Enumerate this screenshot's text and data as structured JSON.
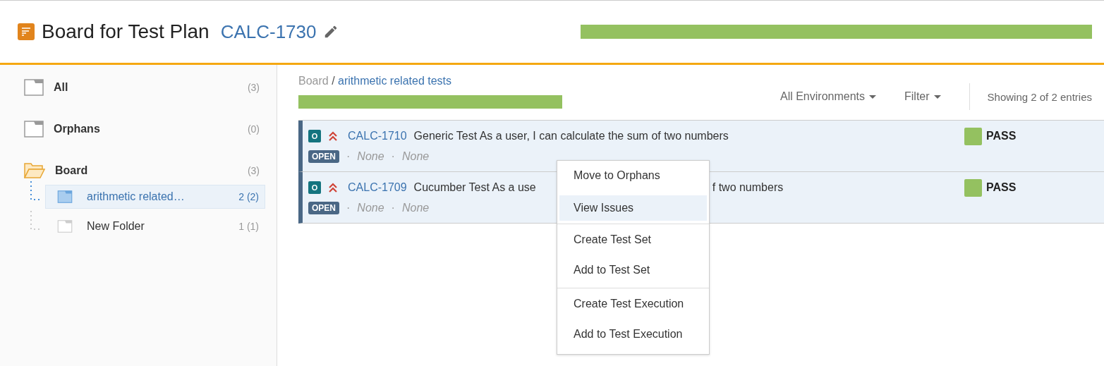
{
  "header": {
    "title": "Board for Test Plan",
    "issue_key": "CALC-1730",
    "progress": {
      "level": 1
    }
  },
  "sidebar": {
    "items": [
      {
        "label": "All",
        "count": "(3)",
        "kind": "plain",
        "selected": false
      },
      {
        "label": "Orphans",
        "count": "(0)",
        "kind": "plain",
        "selected": false
      },
      {
        "label": "Board",
        "count": "(3)",
        "kind": "root",
        "expanded": true,
        "selected": false,
        "children": [
          {
            "label": "arithmetic related…",
            "count": "2 (2)",
            "selected": true
          },
          {
            "label": "New Folder",
            "count": "1 (1)",
            "selected": false
          }
        ]
      }
    ]
  },
  "breadcrumb": {
    "root": "Board",
    "separator": "/",
    "current": "arithmetic related tests"
  },
  "folder_progress": {
    "level": 1
  },
  "toolbar": {
    "environment": "All Environments",
    "filter": "Filter",
    "summary": "Showing 2 of 2 entries"
  },
  "tests": [
    {
      "icon_letter": "O",
      "key": "CALC-1710",
      "summary_parts": [
        "Generic Test As a user, I can calculate the sum of two numbers"
      ],
      "status": "OPEN",
      "separator": "·",
      "meta": [
        "None",
        "None"
      ],
      "result": "PASS",
      "color": "#94c160"
    },
    {
      "icon_letter": "O",
      "key": "CALC-1709",
      "summary_parts": [
        "Cucumber Test As a use",
        "f two numbers"
      ],
      "status": "OPEN",
      "separator": "·",
      "meta": [
        "None",
        "None"
      ],
      "result": "PASS",
      "color": "#94c160"
    }
  ],
  "context_menu": {
    "items": [
      {
        "label": "Move to Orphans",
        "selected": false,
        "divider_before": false
      },
      {
        "label": "View Issues",
        "selected": true,
        "divider_before": false
      },
      {
        "label": "Create Test Set",
        "selected": false,
        "divider_before": true
      },
      {
        "label": "Add to Test Set",
        "selected": false,
        "divider_before": false
      },
      {
        "label": "Create Test Execution",
        "selected": false,
        "divider_before": true
      },
      {
        "label": "Add to Test Execution",
        "selected": false,
        "divider_before": false
      }
    ]
  }
}
